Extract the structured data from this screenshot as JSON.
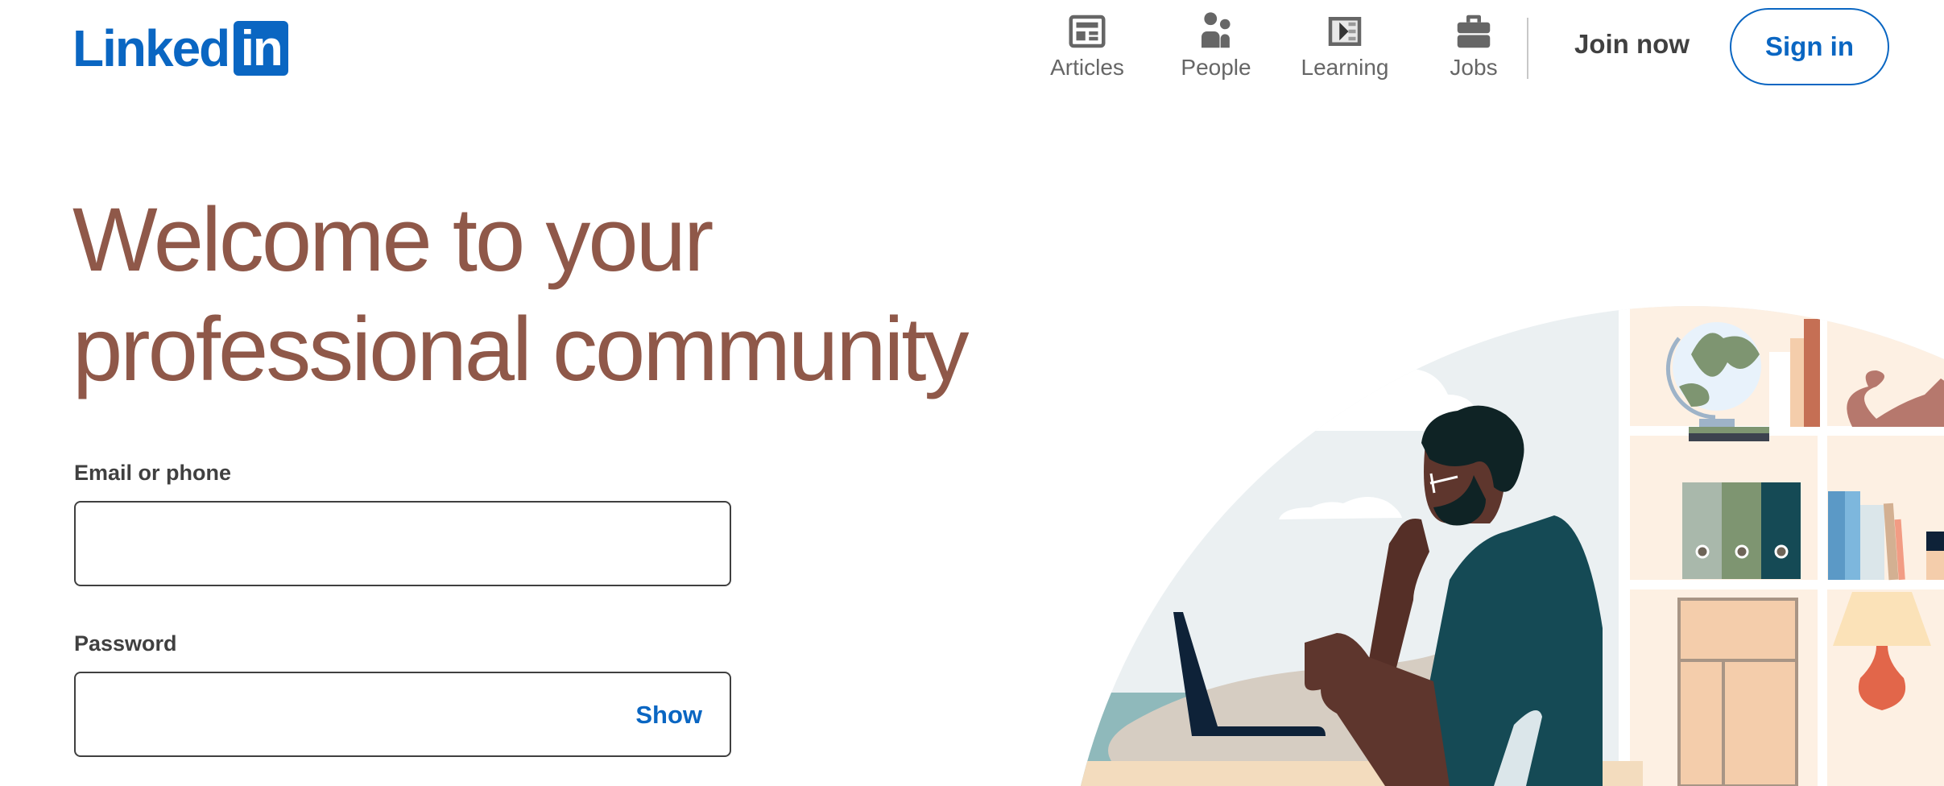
{
  "header": {
    "logo": {
      "text": "Linked",
      "box_text": "in"
    },
    "nav": [
      {
        "label": "Articles",
        "icon": "articles-icon"
      },
      {
        "label": "People",
        "icon": "people-icon"
      },
      {
        "label": "Learning",
        "icon": "learning-icon"
      },
      {
        "label": "Jobs",
        "icon": "jobs-icon"
      }
    ],
    "join_label": "Join now",
    "signin_label": "Sign in"
  },
  "hero": {
    "headline_line1": "Welcome to your",
    "headline_line2": "professional community"
  },
  "form": {
    "email_label": "Email or phone",
    "email_value": "",
    "password_label": "Password",
    "password_value": "",
    "show_label": "Show"
  },
  "colors": {
    "brand": "#0a66c2",
    "headline": "#8f5849",
    "text": "#404040"
  }
}
